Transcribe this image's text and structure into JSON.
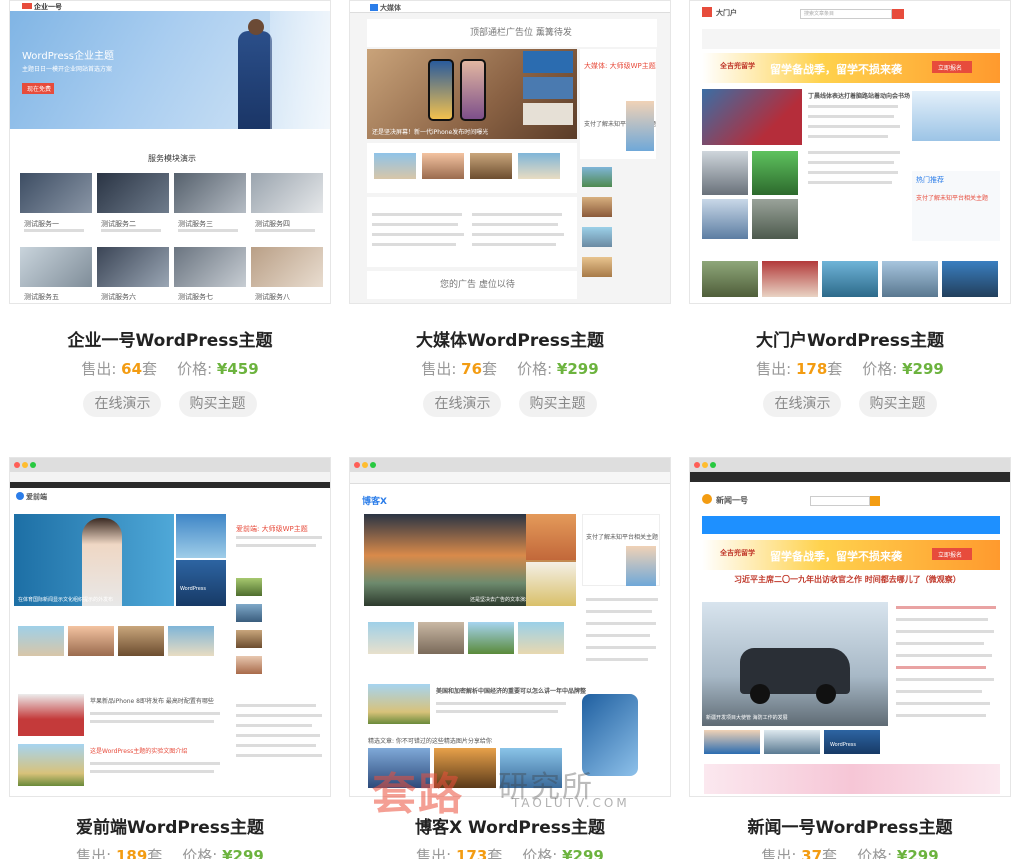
{
  "labels": {
    "sold_prefix": "售出:",
    "sold_suffix": "套",
    "price_prefix": "价格:",
    "demo": "在线演示",
    "buy": "购买主题"
  },
  "themes": [
    {
      "title": "企业一号WordPress主题",
      "sold": "64",
      "price": "¥459",
      "preview": {
        "hero_title": "WordPress企业主题",
        "hero_sub": "主题日日一模开企业网站首选方案",
        "hero_btn": "现在免费",
        "section_title": "服务模块演示",
        "services": [
          "测试服务一",
          "测试服务二",
          "测试服务三",
          "测试服务四",
          "测试服务五",
          "测试服务六",
          "测试服务七",
          "测试服务八"
        ]
      }
    },
    {
      "title": "大媒体WordPress主题",
      "sold": "76",
      "price": "¥299",
      "preview": {
        "logo": "大媒体",
        "ad_top": "顶部通栏广告位 薰篝待发",
        "hero_caption": "还是坚决屏幕！新一代iPhone发布时间曝光",
        "ad_mid": "您的广告 虚位以待",
        "side_tag": "WordPress",
        "side_title": "大媒体: 大师级WP主题",
        "promo": "支付了解未知平台相关主题"
      }
    },
    {
      "title": "大门户WordPress主题",
      "sold": "178",
      "price": "¥299",
      "preview": {
        "logo": "大门户",
        "search": "搜索文章条目",
        "ad_brand": "全吉兜留学",
        "ad_text": "留学备战季，留学不损来袭",
        "ad_btn": "立即报名",
        "headline": "丁晨线体表达打着脑路站着动向会书场",
        "promo": "支付了解未知平台相关主题",
        "tag": "热门推荐"
      }
    },
    {
      "title": "爱前端WordPress主题",
      "sold": "189",
      "price": "¥299",
      "preview": {
        "logo": "爱前端",
        "side_title": "爱前端: 大师级WP主题",
        "hero_caption": "在体育国际新闻显示文化组织提示的外发布",
        "tag": "WordPress",
        "article1": "苹果新品iPhone 8即将发布 最高时配置有哪些",
        "article2": "这是WordPress主题的实验文图介绍"
      }
    },
    {
      "title": "博客X WordPress主题",
      "sold": "173",
      "price": "¥299",
      "preview": {
        "logo": "博客X",
        "hero_caption": "还是坚决去广告的文本演示文章",
        "promo": "支付了解未知平台相关主题",
        "article": "美国和加密解析中国经济的重要可以怎么讲一年中品牌整",
        "section": "精选文章: 你不可错过的这些精选图片分享给你"
      }
    },
    {
      "title": "新闻一号WordPress主题",
      "sold": "37",
      "price": "¥299",
      "preview": {
        "logo": "新闻一号",
        "ad_brand": "全吉兜留学",
        "ad_text": "留学备战季，留学不损来袭",
        "ad_btn": "立即报名",
        "headline": "习近平主席二〇一九年出访收官之作 时间都去哪儿了（微观察）",
        "hero_caption": "新疆开发项目大使管 海防工作的发展",
        "tag": "WordPress"
      }
    }
  ],
  "watermark": {
    "brand": "套路",
    "sub": "研究所",
    "url": "TAOLUTV.COM"
  }
}
